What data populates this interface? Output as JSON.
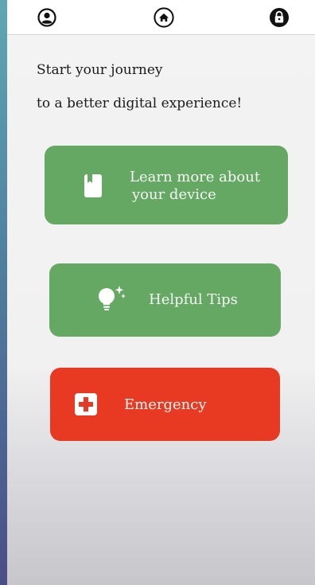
{
  "topbar": {
    "profile_icon": "user-circle-icon",
    "home_icon": "home-icon",
    "lock_icon": "lock-icon"
  },
  "headline": {
    "line1": "Start your journey",
    "line2": "to a better digital experience!"
  },
  "cards": {
    "device": {
      "line1": "Learn more about",
      "line2": "your device",
      "icon": "book-icon",
      "color": "#64a863"
    },
    "tips": {
      "label": "Helpful Tips",
      "icon": "lightbulb-icon",
      "color": "#64a863"
    },
    "emergency": {
      "label": "Emergency",
      "icon": "first-aid-icon",
      "color": "#e83a22"
    }
  }
}
